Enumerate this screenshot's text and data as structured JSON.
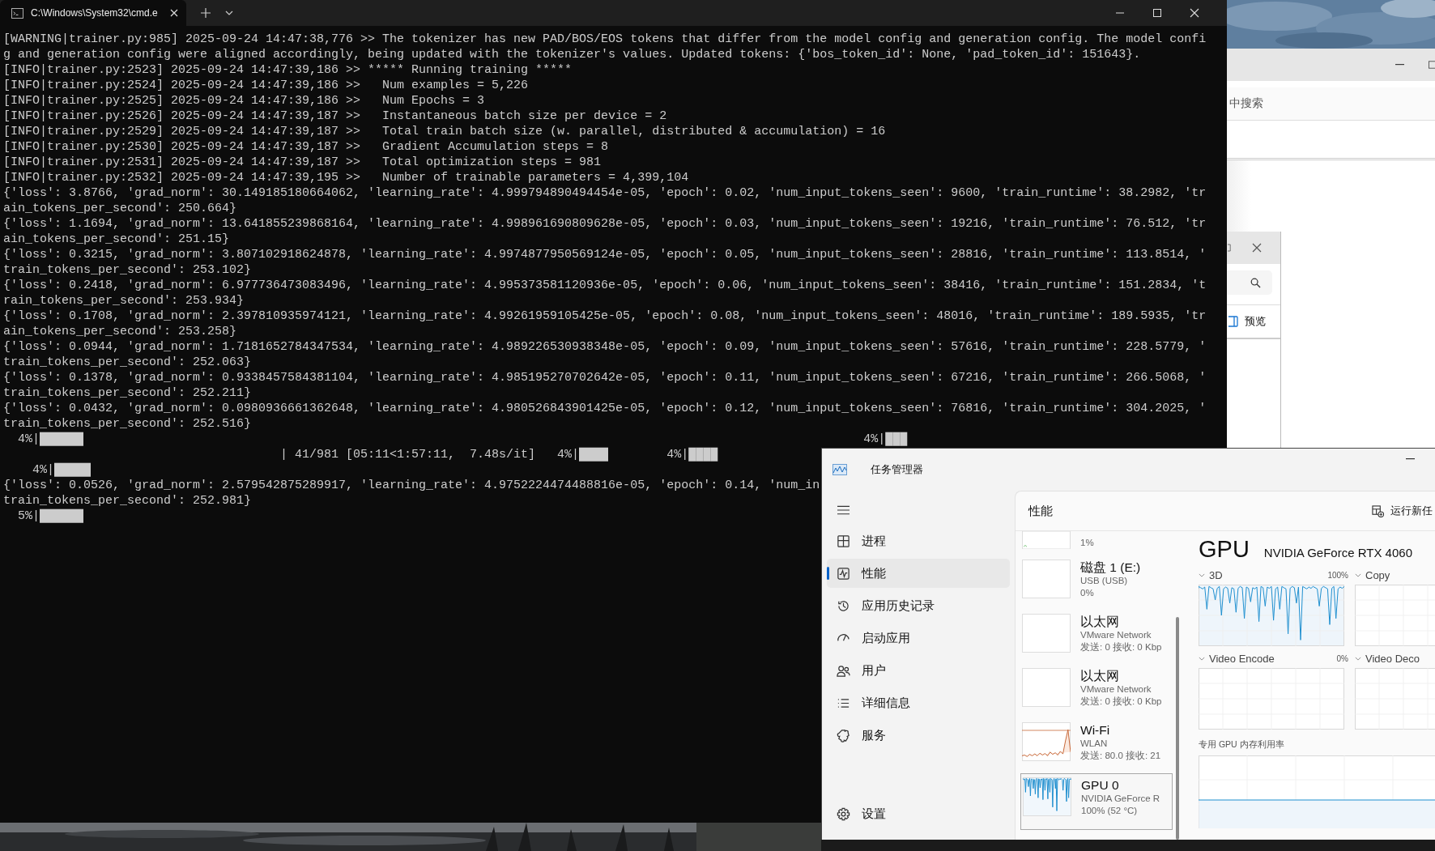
{
  "terminal": {
    "tab_title": "C:\\Windows\\System32\\cmd.e",
    "lines": [
      "[WARNING|trainer.py:985] 2025-09-24 14:47:38,776 >> The tokenizer has new PAD/BOS/EOS tokens that differ from the model config and generation config. The model confi",
      "g and generation config were aligned accordingly, being updated with the tokenizer's values. Updated tokens: {'bos_token_id': None, 'pad_token_id': 151643}.",
      "[INFO|trainer.py:2523] 2025-09-24 14:47:39,186 >> ***** Running training *****",
      "[INFO|trainer.py:2524] 2025-09-24 14:47:39,186 >>   Num examples = 5,226",
      "[INFO|trainer.py:2525] 2025-09-24 14:47:39,186 >>   Num Epochs = 3",
      "[INFO|trainer.py:2526] 2025-09-24 14:47:39,187 >>   Instantaneous batch size per device = 2",
      "[INFO|trainer.py:2529] 2025-09-24 14:47:39,187 >>   Total train batch size (w. parallel, distributed & accumulation) = 16",
      "[INFO|trainer.py:2530] 2025-09-24 14:47:39,187 >>   Gradient Accumulation steps = 8",
      "[INFO|trainer.py:2531] 2025-09-24 14:47:39,187 >>   Total optimization steps = 981",
      "[INFO|trainer.py:2532] 2025-09-24 14:47:39,195 >>   Number of trainable parameters = 4,399,104",
      "{'loss': 3.8766, 'grad_norm': 30.149185180664062, 'learning_rate': 4.999794890494454e-05, 'epoch': 0.02, 'num_input_tokens_seen': 9600, 'train_runtime': 38.2982, 'tr",
      "ain_tokens_per_second': 250.664}",
      "{'loss': 1.1694, 'grad_norm': 13.641855239868164, 'learning_rate': 4.998961690809628e-05, 'epoch': 0.03, 'num_input_tokens_seen': 19216, 'train_runtime': 76.512, 'tr",
      "ain_tokens_per_second': 251.15}",
      "{'loss': 0.3215, 'grad_norm': 3.807102918624878, 'learning_rate': 4.9974877950569124e-05, 'epoch': 0.05, 'num_input_tokens_seen': 28816, 'train_runtime': 113.8514, '",
      "train_tokens_per_second': 253.102}",
      "{'loss': 0.2418, 'grad_norm': 6.977736473083496, 'learning_rate': 4.995373581120936e-05, 'epoch': 0.06, 'num_input_tokens_seen': 38416, 'train_runtime': 151.2834, 't",
      "rain_tokens_per_second': 253.934}",
      "{'loss': 0.1708, 'grad_norm': 2.397810935974121, 'learning_rate': 4.99261959105425e-05, 'epoch': 0.08, 'num_input_tokens_seen': 48016, 'train_runtime': 189.5935, 'tr",
      "ain_tokens_per_second': 253.258}",
      "{'loss': 0.0944, 'grad_norm': 1.7181652784347534, 'learning_rate': 4.989226530938348e-05, 'epoch': 0.09, 'num_input_tokens_seen': 57616, 'train_runtime': 228.5779, '",
      "train_tokens_per_second': 252.063}",
      "{'loss': 0.1378, 'grad_norm': 0.9338457584381104, 'learning_rate': 4.985195270702642e-05, 'epoch': 0.11, 'num_input_tokens_seen': 67216, 'train_runtime': 266.5068, '",
      "train_tokens_per_second': 252.211}",
      "{'loss': 0.0432, 'grad_norm': 0.0980936661362648, 'learning_rate': 4.980526843901425e-05, 'epoch': 0.12, 'num_input_tokens_seen': 76816, 'train_runtime': 304.2025, '",
      "train_tokens_per_second': 252.516}",
      "  4%|██████                                                                                                           4%|███",
      "                                      | 41/981 [05:11<1:57:11,  7.48s/it]   4%|████        4%|████",
      "    4%|█████",
      "{'loss': 0.0526, 'grad_norm': 2.579542875289917, 'learning_rate': 4.9752224474488816e-05, 'epoch': 0.14, 'num_in",
      "train_tokens_per_second': 252.981}",
      "  5%|██████"
    ]
  },
  "explorer": {
    "search_hint": "中搜索",
    "preview_label": "预览"
  },
  "task_manager": {
    "title": "任务管理器",
    "page_title": "性能",
    "run_task": "运行新任",
    "nav": [
      {
        "kind": "processes",
        "label": "进程",
        "selected": false
      },
      {
        "kind": "performance",
        "label": "性能",
        "selected": true
      },
      {
        "kind": "history",
        "label": "应用历史记录",
        "selected": false
      },
      {
        "kind": "startup",
        "label": "启动应用",
        "selected": false
      },
      {
        "kind": "users",
        "label": "用户",
        "selected": false
      },
      {
        "kind": "details",
        "label": "详细信息",
        "selected": false
      },
      {
        "kind": "services",
        "label": "服务",
        "selected": false
      }
    ],
    "settings": "设置",
    "devices": [
      {
        "kind": "disk",
        "value": "1%",
        "selected": false
      },
      {
        "kind": "empty",
        "name": "磁盘 1 (E:)",
        "sub": "USB (USB)",
        "value": "0%",
        "selected": false
      },
      {
        "kind": "empty",
        "name": "以太网",
        "sub": "VMware Network",
        "value": "发送: 0 接收: 0 Kbp",
        "selected": false
      },
      {
        "kind": "empty",
        "name": "以太网",
        "sub": "VMware Network",
        "value": "发送: 0 接收: 0 Kbp",
        "selected": false
      },
      {
        "kind": "wifi",
        "name": "Wi-Fi",
        "sub": "WLAN",
        "value": "发送: 80.0 接收: 21",
        "selected": false
      },
      {
        "kind": "gpu",
        "name": "GPU 0",
        "sub": "NVIDIA GeForce R",
        "value": "100% (52 °C)",
        "selected": true
      }
    ],
    "gpu": {
      "heading": "GPU",
      "model": "NVIDIA GeForce RTX 4060",
      "engines": [
        {
          "label": "3D",
          "reading": "100%",
          "kind": "gpu"
        },
        {
          "label": "Copy",
          "kind": "empty"
        },
        {
          "label": "Video Encode",
          "reading": "0%",
          "kind": "empty"
        },
        {
          "label": "Video Deco",
          "kind": "empty"
        }
      ],
      "memory_label": "专用 GPU 内存利用率"
    }
  }
}
